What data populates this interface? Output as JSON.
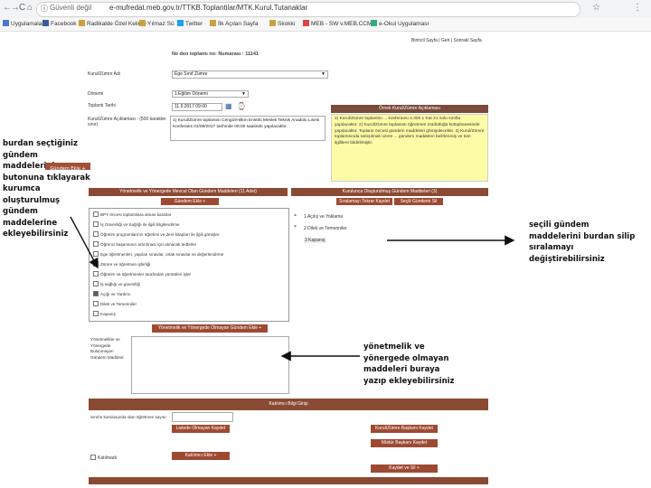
{
  "browser": {
    "nav_icons": [
      "←",
      "→",
      "C",
      "⌂"
    ],
    "site_info": "Güvenli değil",
    "url": "e-mufredat.meb.gov.tr/TTKB.Toplantilar/MTK.Kurul.Tutanaklar",
    "bookmarks": [
      "Uygulamalar",
      "Facebook",
      "Radikalde Özel Kelime",
      "Yılmaz Sü",
      "Twitter",
      "İlk Açılan Sayfa",
      "Skokki",
      "MEB - SW v.MEB.CCM",
      "e-Okul Uygulaması"
    ]
  },
  "page": {
    "top_links": "Birincil Sayfa | Geri | Sonraki Sayfa",
    "meeting_title": "Ne den toplantı no: Numarası : 11141",
    "form": {
      "kurul_label": "Kurul/Zümre Adı",
      "kurul_value": "Ege Sınıf Zümre",
      "donem_label": "Dönemi",
      "donem_value": "1 Eğitim Dönemi",
      "tarih_label": "Toplantı Tarihi",
      "tarih_value": "11.9.2017 09:00",
      "aciklama_label": "Kurul/Zümre Açıklaması : (500 karakter sınır)",
      "aciklama_value": "1) Kurul/Zümre toplantısı Cengiz/Hilton Enstitü Meslek Teknik Anadolu Lisesi Konferans 01/09/2017 tarihinde 08:00 saatinde yapılacaktır."
    },
    "sample": {
      "title": "Örnek Kurul/Zümre Açıklaması",
      "text": "1) Kurul/Zümre toplantısı ... konferansı 4.300 1 Kat 21 nolu sınıfta yapılacaktır. 2) Kurul/Zümre toplantısı öğretmen müdürlüğü kütüphanesinde yapılacaktır. Toplantı öncesi gündem maddeleri görüşülecektir. 3) Kurul/Zümre toplantısında tartışılmak üzere ... gündem maddeleri belirlenmiş ve tüm ilgililere bildirilmiştir."
    },
    "left_panel": {
      "header": "Yönetmelik ve Yönergede Mevcut Olan Gündem Maddeleri (11 Adet)",
      "button": "Gündem Ekle +",
      "items": [
        {
          "label": "BPY öncesi toplantılara alınan kararlar",
          "checked": false
        },
        {
          "label": "İş Güvenliği ve Sağlığı ile ilgili bilgilendirme",
          "checked": false
        },
        {
          "label": "Öğretim programlarının öğretimi ve ders kitapları ile ilgili görüşler",
          "checked": false
        },
        {
          "label": "Öğrenci başarısının artırılması için alınacak tedbirler",
          "checked": false
        },
        {
          "label": "Ege öğretmenleri, yapılan sınavlar, ortak sınavlar ve değerlendirme",
          "checked": false
        },
        {
          "label": "Zümre ve öğretmen işbirliği",
          "checked": false
        },
        {
          "label": "Öğretim ve öğretmenler tarafından yürütülen işler",
          "checked": false
        },
        {
          "label": "İş sağlığı ve güvenliği",
          "checked": false
        },
        {
          "label": "Açığı ve Yardımı",
          "checked": true
        },
        {
          "label": "Dilek ve Temenniler",
          "checked": false
        },
        {
          "label": "Kapanış",
          "checked": false
        }
      ],
      "bottom_button": "Yönetmelik ve Yönergede Olmayan Gündem Ekle +"
    },
    "right_panel": {
      "header": "Kurulunca Oluşturulmuş Gündem Maddeleri (3)",
      "save_button": "Sıralamayı Tekrar Kaydet",
      "delete_button": "Seçili Gündemi Sil",
      "items": [
        "1 Açılış ve Yoklama",
        "2 Dilek ve Temenniler",
        "3 Kapanış"
      ]
    },
    "other_agenda_label": "Yönetmelikte ve Yönergede Bulunmayan Gündem Maddesi:",
    "attendance": {
      "header": "Katılımcı Bilgi Girişi",
      "count_label": "Sınıfın kurulusunda olan öğretmen sayısı:",
      "add_teacher": "Listede Olmayan Kaydet",
      "start_button": "Kurul/Zümre Başkanı Kaydet",
      "head_button": "Müdür Başkanı Kaydet",
      "absent_label": "Katılmadı",
      "add_button": "Katılımcı Ekle +",
      "save_all": "Kaydet ve Sil +"
    }
  },
  "annotations": {
    "left_top": [
      "burdan seçtiğiniz gündem",
      "maddelerini",
      "butonuna tıklayarak",
      "kurumca oluşturulmuş",
      "gündem maddelerine",
      "ekleyebilirsiniz"
    ],
    "left_button": "Gündem Ekle +",
    "right_middle": [
      "seçili gündem",
      "maddelerini burdan silip",
      "sıralamayı",
      "değiştirebilirsiniz"
    ],
    "bottom": [
      "yönetmelik ve",
      "yönergede olmayan",
      "maddeleri buraya",
      "yazıp ekleyebilirsiniz"
    ]
  }
}
